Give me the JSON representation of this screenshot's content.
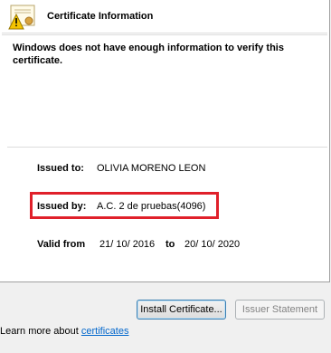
{
  "header": {
    "title": "Certificate Information"
  },
  "message": "Windows does not have enough information to verify this certificate.",
  "fields": {
    "issued_to_label": "Issued to:",
    "issued_to_value": "OLIVIA MORENO LEON",
    "issued_by_label": "Issued by:",
    "issued_by_value": "A.C. 2 de pruebas(4096)",
    "valid_from_label": "Valid from",
    "valid_from_value": "21/ 10/ 2016",
    "to_label": "to",
    "valid_to_value": "20/ 10/ 2020"
  },
  "buttons": {
    "install": "Install Certificate...",
    "issuer_statement": "Issuer Statement"
  },
  "footer": {
    "prefix": "Learn more about ",
    "link": "certificates"
  },
  "colors": {
    "highlight": "#e0202a",
    "link": "#0066cc"
  }
}
